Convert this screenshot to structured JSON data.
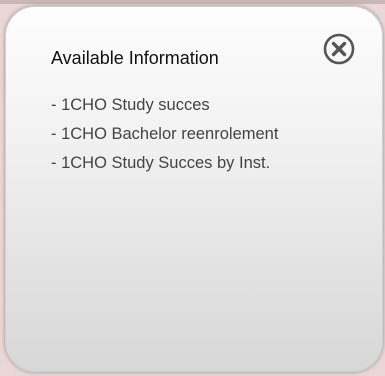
{
  "panel": {
    "title": "Available Information",
    "close_icon": "close-circle-icon",
    "items": [
      {
        "label": "- 1CHO Study succes"
      },
      {
        "label": "- 1CHO Bachelor reenrolement"
      },
      {
        "label": "- 1CHO Study Succes by Inst."
      }
    ]
  },
  "colors": {
    "background": "#ead8d8",
    "panel_top": "#fdfdfd",
    "panel_bottom": "#d7d7d7",
    "icon": "#555555",
    "title_text": "#111111",
    "item_text": "#444444"
  }
}
